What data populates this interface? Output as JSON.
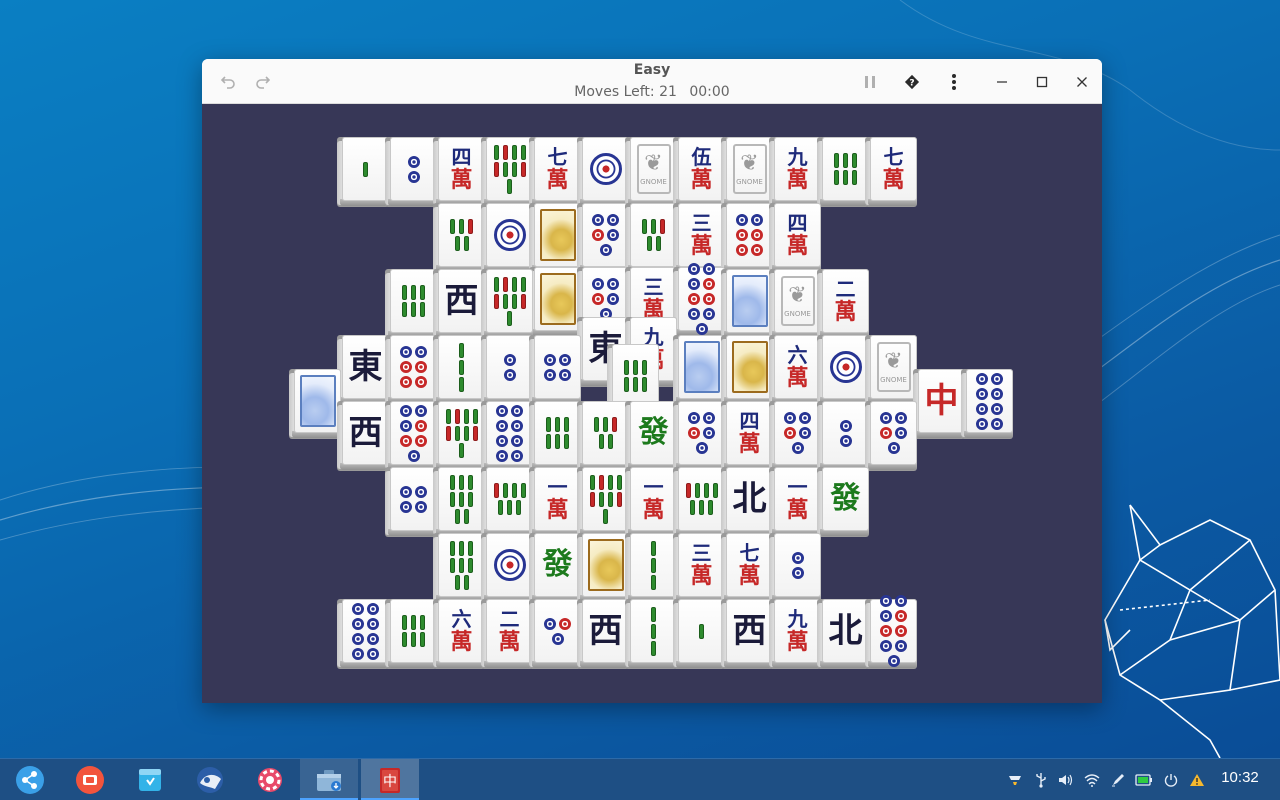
{
  "window": {
    "title": "Easy",
    "moves_label": "Moves Left: 21",
    "timer": "00:00"
  },
  "titlebar_icons": {
    "undo": "undo-icon",
    "redo": "redo-icon",
    "pause": "pause-icon",
    "hint": "hint-icon",
    "menu": "menu-icon",
    "minimize": "minimize-icon",
    "maximize": "maximize-icon",
    "close": "close-icon"
  },
  "colors": {
    "board": "#373757",
    "taskbar": "#1e4f84",
    "char_blue": "#1e2a7a",
    "char_red": "#c62828",
    "bamboo_green": "#2e8b2e"
  },
  "tiles": [
    {
      "kind": "bamboo",
      "n": 1
    },
    {
      "kind": "dots",
      "n": 2
    },
    {
      "kind": "char",
      "top": "四",
      "bot": "萬"
    },
    {
      "kind": "bamboo",
      "n": 9
    },
    {
      "kind": "char",
      "top": "七",
      "bot": "萬"
    },
    {
      "kind": "bigdot"
    },
    {
      "kind": "gnome",
      "label": "GNOME"
    },
    {
      "kind": "char",
      "top": "伍",
      "bot": "萬"
    },
    {
      "kind": "gnome",
      "label": "GNOME"
    },
    {
      "kind": "char",
      "top": "九",
      "bot": "萬"
    },
    {
      "kind": "bamboo",
      "n": 6
    },
    {
      "kind": "char",
      "top": "七",
      "bot": "萬"
    },
    {
      "kind": "bamboo",
      "n": 5
    },
    {
      "kind": "bigdot"
    },
    {
      "kind": "flower"
    },
    {
      "kind": "dots",
      "n": 5
    },
    {
      "kind": "bamboo",
      "n": 5
    },
    {
      "kind": "char",
      "top": "三",
      "bot": "萬"
    },
    {
      "kind": "dots",
      "n": 6
    },
    {
      "kind": "char",
      "top": "四",
      "bot": "萬"
    },
    {
      "kind": "bamboo",
      "n": 6
    },
    {
      "kind": "honor",
      "text": "西"
    },
    {
      "kind": "bamboo",
      "n": 9
    },
    {
      "kind": "flower"
    },
    {
      "kind": "dots",
      "n": 5
    },
    {
      "kind": "char",
      "top": "三",
      "bot": "萬"
    },
    {
      "kind": "dots",
      "n": 9
    },
    {
      "kind": "season"
    },
    {
      "kind": "gnome",
      "label": "GNOME"
    },
    {
      "kind": "char",
      "top": "二",
      "bot": "萬"
    },
    {
      "kind": "season"
    },
    {
      "kind": "honor",
      "text": "東"
    },
    {
      "kind": "dots",
      "n": 6
    },
    {
      "kind": "bamboo",
      "n": 3
    },
    {
      "kind": "dots",
      "n": 2
    },
    {
      "kind": "dots",
      "n": 4
    },
    {
      "kind": "honor",
      "text": "東"
    },
    {
      "kind": "char",
      "top": "九",
      "bot": "萬"
    },
    {
      "kind": "season"
    },
    {
      "kind": "flower"
    },
    {
      "kind": "char",
      "top": "六",
      "bot": "萬"
    },
    {
      "kind": "bigdot"
    },
    {
      "kind": "gnome",
      "label": "GNOME"
    },
    {
      "kind": "red",
      "text": "中"
    },
    {
      "kind": "dots",
      "n": 8
    },
    {
      "kind": "bamboo",
      "n": 6
    },
    {
      "kind": "honor",
      "text": "西"
    },
    {
      "kind": "dots",
      "n": 7
    },
    {
      "kind": "bamboo",
      "n": 9
    },
    {
      "kind": "dots",
      "n": 8
    },
    {
      "kind": "bamboo",
      "n": 6
    },
    {
      "kind": "bamboo",
      "n": 5
    },
    {
      "kind": "green",
      "text": "發"
    },
    {
      "kind": "dots",
      "n": 5
    },
    {
      "kind": "char",
      "top": "四",
      "bot": "萬"
    },
    {
      "kind": "dots",
      "n": 5
    },
    {
      "kind": "dots",
      "n": 2
    },
    {
      "kind": "dots",
      "n": 5
    },
    {
      "kind": "dots",
      "n": 4
    },
    {
      "kind": "bamboo",
      "n": 8
    },
    {
      "kind": "bamboo",
      "n": 7
    },
    {
      "kind": "char",
      "top": "一",
      "bot": "萬"
    },
    {
      "kind": "bamboo",
      "n": 9
    },
    {
      "kind": "char",
      "top": "一",
      "bot": "萬"
    },
    {
      "kind": "bamboo",
      "n": 7
    },
    {
      "kind": "honor",
      "text": "北"
    },
    {
      "kind": "char",
      "top": "一",
      "bot": "萬"
    },
    {
      "kind": "green",
      "text": "發"
    },
    {
      "kind": "bamboo",
      "n": 8
    },
    {
      "kind": "bigdot"
    },
    {
      "kind": "green",
      "text": "發"
    },
    {
      "kind": "flower"
    },
    {
      "kind": "bamboo",
      "n": 3
    },
    {
      "kind": "char",
      "top": "三",
      "bot": "萬"
    },
    {
      "kind": "char",
      "top": "七",
      "bot": "萬"
    },
    {
      "kind": "dots",
      "n": 2
    },
    {
      "kind": "dots",
      "n": 8
    },
    {
      "kind": "bamboo",
      "n": 6
    },
    {
      "kind": "char",
      "top": "六",
      "bot": "萬"
    },
    {
      "kind": "char",
      "top": "二",
      "bot": "萬"
    },
    {
      "kind": "dots",
      "n": 3
    },
    {
      "kind": "honor",
      "text": "西"
    },
    {
      "kind": "bamboo",
      "n": 3
    },
    {
      "kind": "bamboo",
      "n": 1
    },
    {
      "kind": "honor",
      "text": "西"
    },
    {
      "kind": "char",
      "top": "九",
      "bot": "萬"
    },
    {
      "kind": "honor",
      "text": "北"
    },
    {
      "kind": "dots",
      "n": 9
    }
  ],
  "taskbar": {
    "apps": [
      "launcher-icon",
      "screen-recorder-icon",
      "app-store-icon",
      "mail-icon",
      "settings-icon",
      "files-icon",
      "mahjongg-icon"
    ],
    "tray": [
      "network-status-icon",
      "usb-icon",
      "volume-icon",
      "wifi-icon",
      "pen-icon",
      "battery-icon",
      "power-icon",
      "warning-icon"
    ],
    "clock": "10:32"
  }
}
